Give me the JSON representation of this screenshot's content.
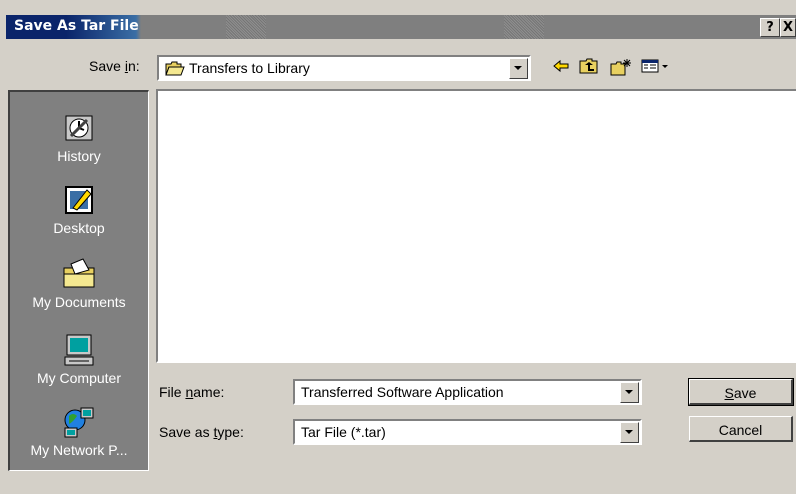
{
  "window": {
    "title": "Save As Tar File",
    "help_label": "?",
    "close_label": "X"
  },
  "save_in": {
    "label_pre": "Save ",
    "label_accel": "i",
    "label_post": "n:",
    "value": "Transfers to Library"
  },
  "toolbar": {
    "back_icon": "←",
    "up_icon": "folder-up-icon",
    "new_folder_icon": "new-folder-icon",
    "views_icon": "views-menu-icon"
  },
  "places": [
    {
      "label": "History",
      "icon": "history-icon"
    },
    {
      "label": "Desktop",
      "icon": "desktop-icon"
    },
    {
      "label": "My Documents",
      "icon": "my-documents-icon"
    },
    {
      "label": "My Computer",
      "icon": "my-computer-icon"
    },
    {
      "label": "My Network P...",
      "icon": "network-places-icon"
    }
  ],
  "file_name": {
    "label_pre": "File ",
    "label_accel": "n",
    "label_post": "ame:",
    "value": "Transferred Software Application"
  },
  "save_as_type": {
    "label_pre": "Save as ",
    "label_accel": "t",
    "label_post": "ype:",
    "value": "Tar File (*.tar)"
  },
  "buttons": {
    "save_accel": "S",
    "save_rest": "ave",
    "cancel": "Cancel"
  }
}
